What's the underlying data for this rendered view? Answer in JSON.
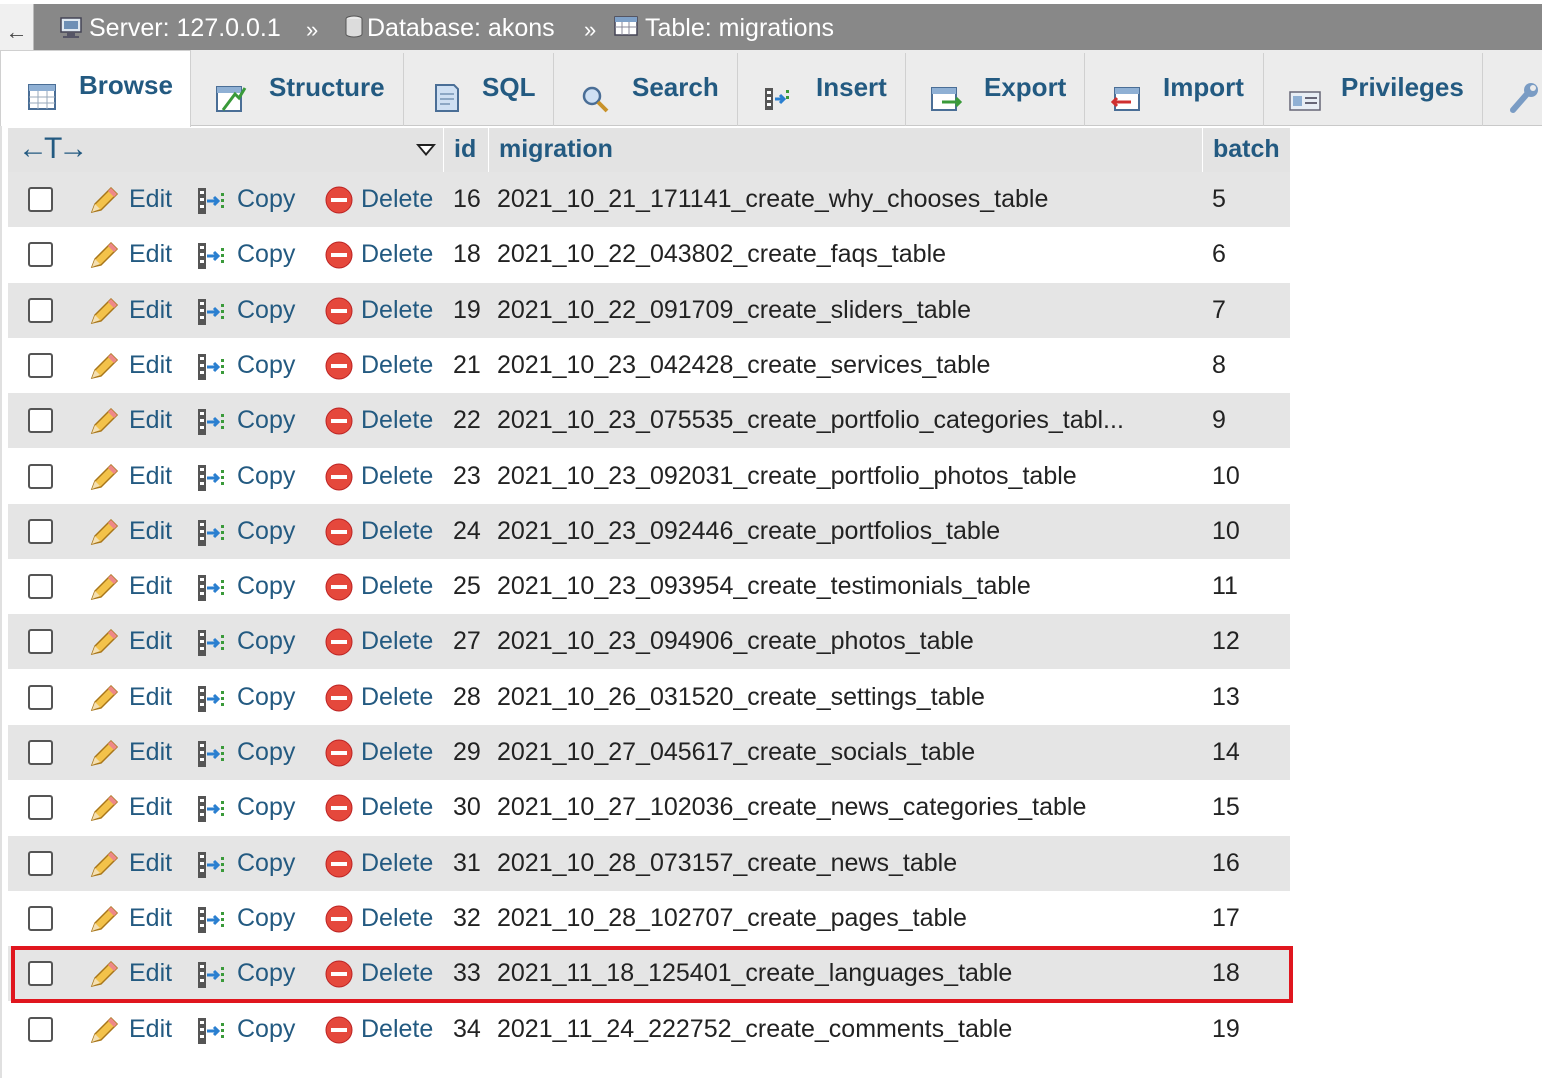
{
  "breadcrumb": {
    "back_symbol": "←",
    "separator": "»",
    "server": "Server: 127.0.0.1",
    "database": "Database: akons",
    "table": "Table: migrations"
  },
  "tabs": [
    {
      "label": "Browse",
      "icon": "browse-icon",
      "active": true
    },
    {
      "label": "Structure",
      "icon": "structure-icon",
      "active": false
    },
    {
      "label": "SQL",
      "icon": "sql-icon",
      "active": false
    },
    {
      "label": "Search",
      "icon": "search-icon",
      "active": false
    },
    {
      "label": "Insert",
      "icon": "insert-icon",
      "active": false
    },
    {
      "label": "Export",
      "icon": "export-icon",
      "active": false
    },
    {
      "label": "Import",
      "icon": "import-icon",
      "active": false
    },
    {
      "label": "Privileges",
      "icon": "privileges-icon",
      "active": false
    },
    {
      "label": "",
      "icon": "operations-wrench-icon",
      "active": false
    }
  ],
  "table": {
    "columns": [
      "id",
      "migration",
      "batch"
    ],
    "resize_symbol": "←T→",
    "actions": {
      "edit": "Edit",
      "copy": "Copy",
      "delete": "Delete"
    },
    "rows": [
      {
        "id": "16",
        "migration": "2021_10_21_171141_create_why_chooses_table",
        "batch": "5"
      },
      {
        "id": "18",
        "migration": "2021_10_22_043802_create_faqs_table",
        "batch": "6"
      },
      {
        "id": "19",
        "migration": "2021_10_22_091709_create_sliders_table",
        "batch": "7"
      },
      {
        "id": "21",
        "migration": "2021_10_23_042428_create_services_table",
        "batch": "8"
      },
      {
        "id": "22",
        "migration": "2021_10_23_075535_create_portfolio_categories_tabl...",
        "batch": "9"
      },
      {
        "id": "23",
        "migration": "2021_10_23_092031_create_portfolio_photos_table",
        "batch": "10"
      },
      {
        "id": "24",
        "migration": "2021_10_23_092446_create_portfolios_table",
        "batch": "10"
      },
      {
        "id": "25",
        "migration": "2021_10_23_093954_create_testimonials_table",
        "batch": "11"
      },
      {
        "id": "27",
        "migration": "2021_10_23_094906_create_photos_table",
        "batch": "12"
      },
      {
        "id": "28",
        "migration": "2021_10_26_031520_create_settings_table",
        "batch": "13"
      },
      {
        "id": "29",
        "migration": "2021_10_27_045617_create_socials_table",
        "batch": "14"
      },
      {
        "id": "30",
        "migration": "2021_10_27_102036_create_news_categories_table",
        "batch": "15"
      },
      {
        "id": "31",
        "migration": "2021_10_28_073157_create_news_table",
        "batch": "16"
      },
      {
        "id": "32",
        "migration": "2021_10_28_102707_create_pages_table",
        "batch": "17"
      },
      {
        "id": "33",
        "migration": "2021_11_18_125401_create_languages_table",
        "batch": "18"
      },
      {
        "id": "34",
        "migration": "2021_11_24_222752_create_comments_table",
        "batch": "19"
      }
    ],
    "highlighted_row_id": "33"
  },
  "colors": {
    "link": "#235a81",
    "topbar": "#888888",
    "highlight_border": "#e0161e",
    "row_alt": "#e5e5e5"
  }
}
